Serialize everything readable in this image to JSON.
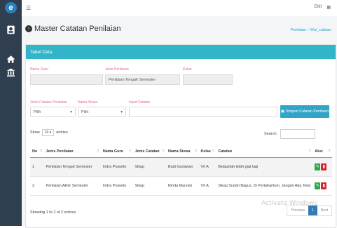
{
  "topbar": {
    "menu_icon": "hamburger-icon",
    "user_label": "EMI",
    "apps_icon": "grid-icon"
  },
  "sidebar": {
    "logo_text": "e",
    "items": [
      "user-icon",
      "home-icon",
      "bank-icon"
    ]
  },
  "page": {
    "title": "Master Catatan Penilaian",
    "breadcrumb": [
      "Penilaian",
      "Wal_catatan"
    ]
  },
  "card": {
    "title": "Tabel Data"
  },
  "form": {
    "nama_guru_label": "Nama Guru",
    "nama_guru_value": "",
    "jenis_penilaian_label": "Jenis Penilaian",
    "jenis_penilaian_value": "Penilaian Tengah Semester",
    "kelas_label": "Kelas",
    "kelas_value": "",
    "jenis_catatan_label": "Jenis Catatan Penilaian",
    "jenis_catatan_value": "Pilih",
    "nama_siswa_label": "Nama Siswa",
    "nama_siswa_value": "Pilih",
    "input_catatan_label": "Input Catatan",
    "input_catatan_value": "",
    "save_label": "Simpan Catatan Penilaian"
  },
  "table_controls": {
    "show_label": "Show",
    "show_value": "10",
    "entries_label": "entries",
    "search_label": "Search:"
  },
  "table": {
    "headers": [
      "No",
      "Jenis Penilaian",
      "Nama Guru",
      "Jenis Catatan",
      "Nama Siswa",
      "Kelas",
      "Catatan",
      "Aksi"
    ],
    "rows": [
      [
        "1",
        "Penilaian Tengah Semester",
        "Indra Prasetio",
        "Sikap",
        "Budi Gunawan",
        "VII A",
        "Belajarlah lebih giat lagi"
      ],
      [
        "2",
        "Penilaian Akhir Semester",
        "Indra Prasetio",
        "Sikap",
        "Rinda Marsiwi",
        "VII A",
        "Sikap Sudah Bagus, Di Pertahankan, Jangan Ada Telat"
      ]
    ]
  },
  "footer": {
    "showing": "Showing 1 to 2 of 2 entries",
    "prev": "Previous",
    "page": "1",
    "next": "Next"
  },
  "watermark": "Activate Windows"
}
